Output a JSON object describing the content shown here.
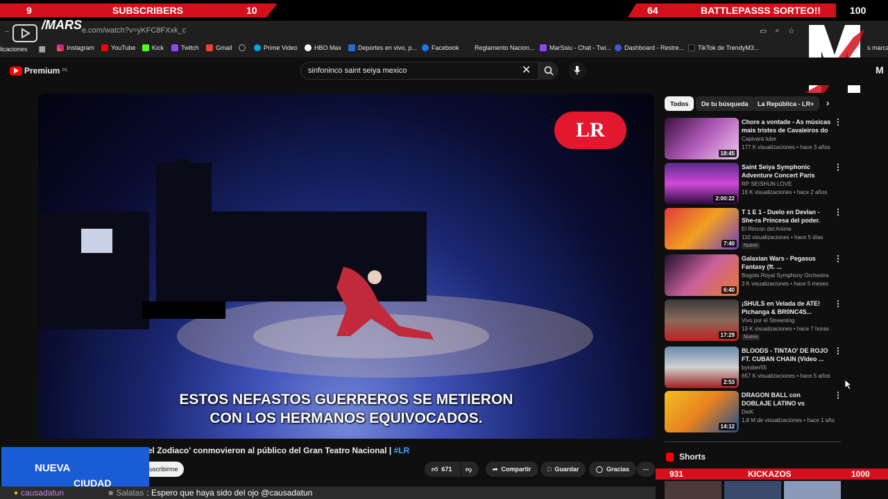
{
  "overlay": {
    "subs_left": "9",
    "subs_label": "SUBSCRIBERS",
    "subs_right": "10",
    "bp_left": "64",
    "bp_label": "BATTLEPASSS SORTEO!!",
    "bp_right": "100",
    "kick_left": "931",
    "kick_label": "KICKAZOS",
    "kick_right": "1000",
    "streamer_tag": "/MARS",
    "nueva": "NUEVA",
    "ciudad": "CIUDAD",
    "chat_user": "causadatun",
    "chat_user2": "Salatas",
    "chat_msg": ": Espero que haya sido del ojo @causadatun"
  },
  "browser": {
    "url": "e.com/watch?v=yKFC8FXxk_c",
    "bookmarks": [
      "licaciones",
      "Instagram",
      "YouTube",
      "Kick",
      "Twitch",
      "Gmail",
      "Prime Video",
      "HBO Max",
      "Deportes en vivo, p...",
      "Facebook",
      "Reglamento Nacion...",
      "MarSsiu - Chat - Twi...",
      "Dashboard - Restre...",
      "TikTok de TrendyM3...",
      "s marca"
    ]
  },
  "youtube": {
    "logo_text": "Premium",
    "logo_sup": "PE",
    "search_value": "sinfoninco saint seiya mexico",
    "video": {
      "badge": "LR",
      "subtitle_line1": "ESTOS NEFASTOS GUERREROS SE METIERON",
      "subtitle_line2": "CON LOS HERMANOS EQUIVOCADOS.",
      "title": "'el Zodiaco' conmovieron al público del Gran Teatro Nacional |",
      "hashtag": "#LR",
      "subscribe_label": "uscribirme",
      "likes": "671",
      "share": "Compartir",
      "save": "Guardar",
      "thanks": "Gracias"
    },
    "chips": [
      "Todos",
      "De tu búsqueda",
      "La República - LR+"
    ],
    "recs": [
      {
        "title": "Chore a vontade - As músicas mais tristes de Cavaleiros do ...",
        "channel": "Capivara tube",
        "meta": "177 K visualizaciones • hace 3 años",
        "dur": "18:45",
        "new": ""
      },
      {
        "title": "Saint Seiya Symphonic Adventure Concert Paris Gran...",
        "channel": "RP SEISHUN LOVE",
        "meta": "16 K visualizaciones • hace 2 años",
        "dur": "2:00:22",
        "new": ""
      },
      {
        "title": "T 1 E 1 - Duelo en Devlan - She-ra Princesa del poder.",
        "channel": "El Rincon del Anime.",
        "meta": "110 visualizaciones • hace 5 días",
        "dur": "7:40",
        "new": "Nuevo"
      },
      {
        "title": "Galaxian Wars - Pegasus Fantasy (ft. ...",
        "channel": "Bogota Royal Symphony Orchestra",
        "meta": "3 K visualizaciones • hace 5 meses",
        "dur": "6:40",
        "new": ""
      },
      {
        "title": "¡SHULS en Velada de ATE! Pichanga & BR0NC4S...",
        "channel": "Vivo por el Streaming",
        "meta": "19 K visualizaciones • hace 7 horas",
        "dur": "17:29",
        "new": "Nuevo"
      },
      {
        "title": "BLOODS - TINTAO' DE ROJO FT. CUBAN CHAIN (Video ...",
        "channel": "byrober55",
        "meta": "657 K visualizaciones • hace 5 años",
        "dur": "2:53",
        "new": ""
      },
      {
        "title": "DRAGON BALL con DOBLAJE LATINO vs ESPAÑOL ¿CUAL E...",
        "channel": "DeiK",
        "meta": "1,8 M de visualizaciones • hace 1 año",
        "dur": "14:12",
        "new": ""
      }
    ],
    "shorts_label": "Shorts"
  },
  "colors": {
    "accent_red": "#d3101b",
    "bg": "#0f0f0f",
    "lr_red": "#e3172d",
    "overlay_blue": "#1a5bd6"
  }
}
